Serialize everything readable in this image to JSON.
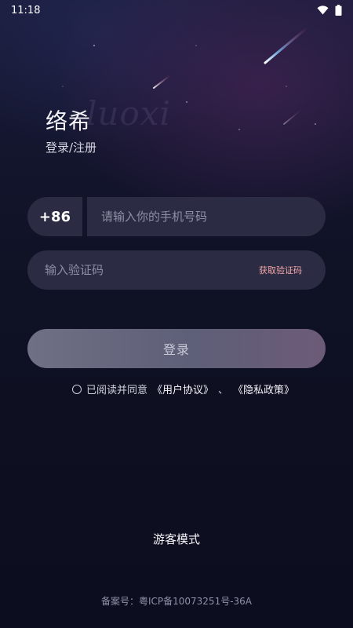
{
  "status_bar": {
    "time": "11:18",
    "icons": [
      "wifi-icon",
      "battery-icon"
    ]
  },
  "brand": {
    "watermark": "luoxi",
    "title": "络希",
    "subtitle": "登录/注册"
  },
  "phone": {
    "country_code": "+86",
    "placeholder": "请输入你的手机号码",
    "value": ""
  },
  "verify": {
    "placeholder": "输入验证码",
    "value": "",
    "get_code_label": "获取验证码"
  },
  "login": {
    "label": "登录"
  },
  "agreement": {
    "prefix": "已阅读并同意",
    "user_agreement": "《用户协议》",
    "separator": "、",
    "privacy_policy": "《隐私政策》",
    "checked": false
  },
  "guest_mode": "游客模式",
  "icp": "备案号：粤ICP备10073251号-36A",
  "colors": {
    "background": "#0f1124",
    "field": "#2b2c44",
    "accent_link": "#f3a6a6"
  }
}
